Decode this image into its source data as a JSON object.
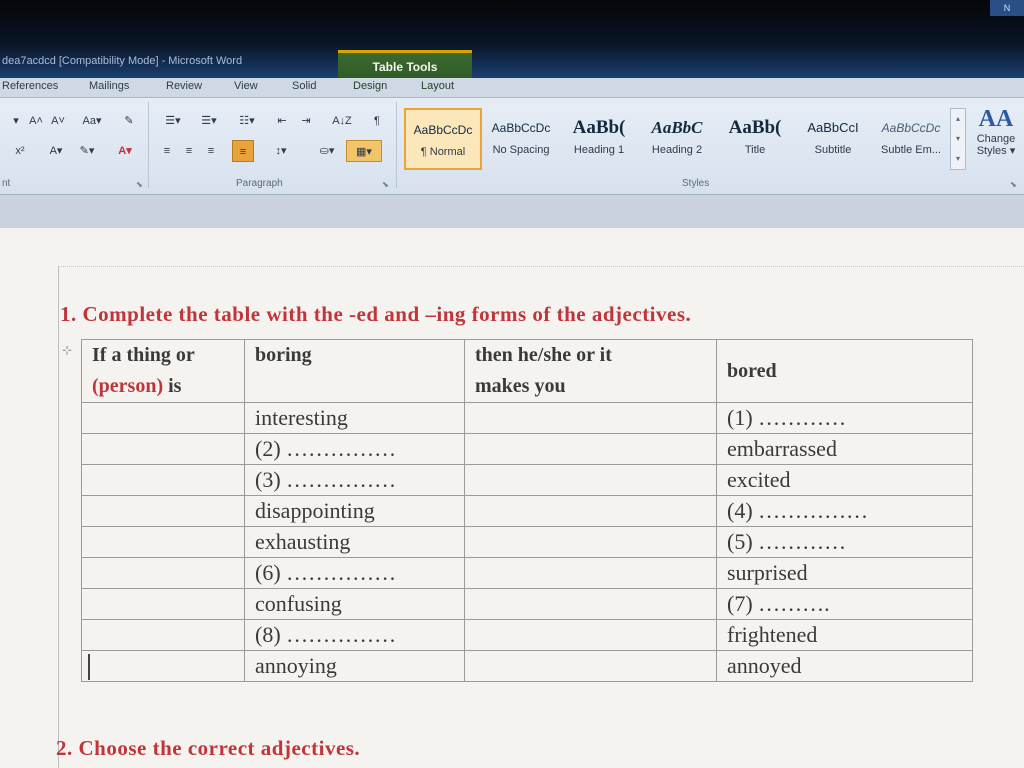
{
  "window": {
    "title": "dea7acdcd [Compatibility Mode] - Microsoft Word",
    "corner_label": "N"
  },
  "contextual_tab_group": "Table Tools",
  "menu_tabs": [
    "References",
    "Mailings",
    "Review",
    "View",
    "Solid",
    "Design",
    "Layout"
  ],
  "ribbon": {
    "font_group_label": "nt",
    "paragraph_group_label": "Paragraph",
    "styles_group_label": "Styles",
    "styles": [
      {
        "preview": "AaBbCcDc",
        "name": "¶ Normal"
      },
      {
        "preview": "AaBbCcDc",
        "name": "No Spacing"
      },
      {
        "preview": "AaBb(",
        "name": "Heading 1"
      },
      {
        "preview": "AaBbC",
        "name": "Heading 2"
      },
      {
        "preview": "AaBb(",
        "name": "Title"
      },
      {
        "preview": "AaBbCcI",
        "name": "Subtitle"
      },
      {
        "preview": "AaBbCcDc",
        "name": "Subtle Em..."
      }
    ],
    "change_styles": {
      "icon": "AA",
      "line1": "Change",
      "line2": "Styles ▾"
    },
    "buttons": {
      "grow_font": "A˄",
      "shrink_font": "A˅",
      "change_case": "Aa▾",
      "clear_format": "✎",
      "bullets": "☰▾",
      "numbering": "☰▾",
      "multilevel": "☷▾",
      "decrease_indent": "⇤",
      "increase_indent": "⇥",
      "sort": "A↓Z",
      "pilcrow": "¶",
      "superscript": "x²",
      "text_effects": "A▾",
      "highlight": "✎▾",
      "font_color": "A▾",
      "align_left": "≡",
      "center": "≡",
      "align_right": "≡",
      "justify": "≡",
      "line_spacing": "↕▾",
      "shading": "⛀▾",
      "borders": "▦▾"
    }
  },
  "document": {
    "heading": "1. Complete the table with the -ed and –ing forms of the adjectives.",
    "heading2": "2. Choose the correct adjectives.",
    "table": {
      "header": {
        "col1_a": "If a thing or",
        "col1_b": "(person)",
        "col1_c": " is",
        "col2": "boring",
        "col3_a": "then he/she or it",
        "col3_b": "makes you",
        "col4": "bored"
      },
      "rows": [
        {
          "ing": "interesting",
          "ed": "(1) …………"
        },
        {
          "ing": "(2) ……………",
          "ed": "embarrassed"
        },
        {
          "ing": "(3) ……………",
          "ed": "excited"
        },
        {
          "ing": "disappointing",
          "ed": "(4) ……………"
        },
        {
          "ing": "exhausting",
          "ed": "(5) …………"
        },
        {
          "ing": "(6) ……………",
          "ed": "surprised"
        },
        {
          "ing": "confusing",
          "ed": "(7) ………."
        },
        {
          "ing": "(8) ……………",
          "ed": "frightened"
        },
        {
          "ing": "annoying",
          "ed": "annoyed"
        }
      ]
    }
  },
  "colors": {
    "heading_red": "#c0343a",
    "table_tools_green": "#2f5a27",
    "selected_style": "#fbe7b9"
  }
}
